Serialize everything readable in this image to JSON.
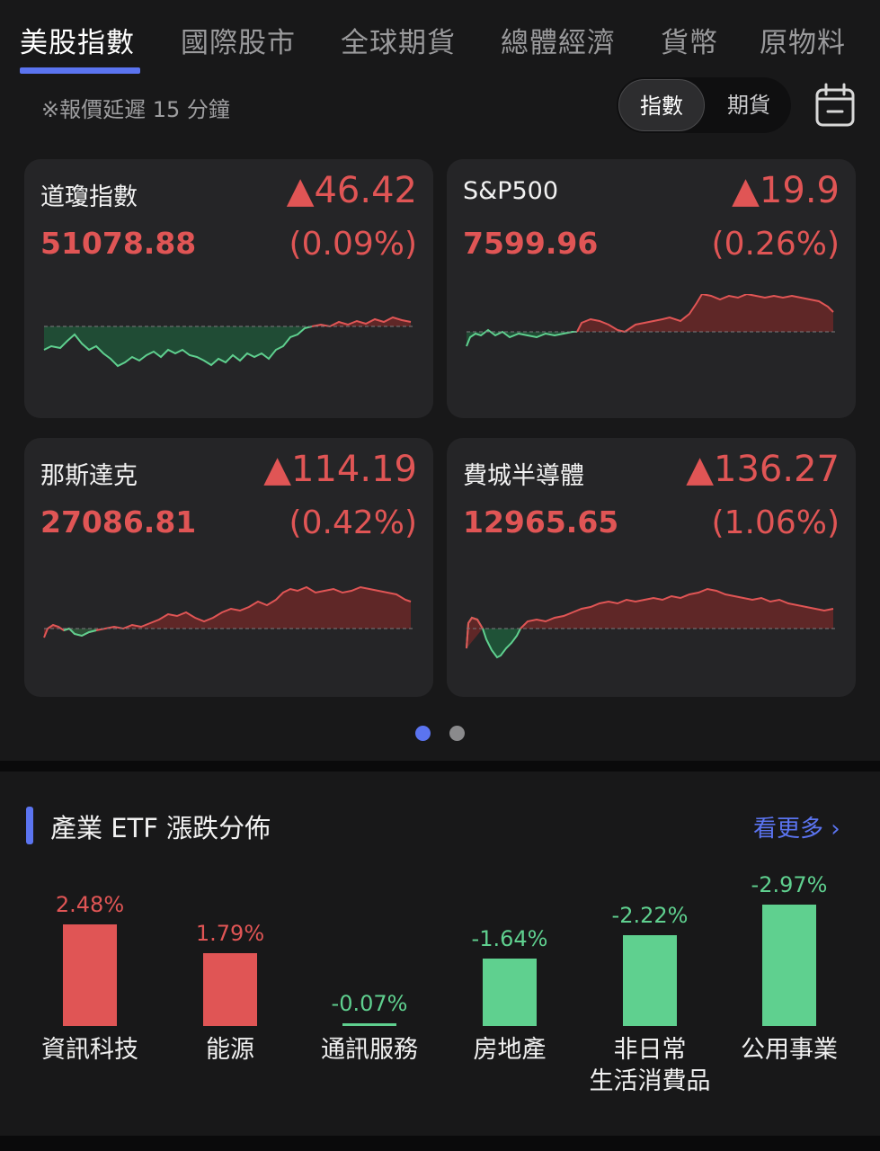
{
  "tabs": [
    "美股指數",
    "國際股市",
    "全球期貨",
    "總體經濟",
    "貨幣",
    "原物料"
  ],
  "delay_note": "※報價延遲 15 分鐘",
  "segment": {
    "active": "指數",
    "inactive": "期貨"
  },
  "colors": {
    "up": "#e05555",
    "down": "#5fd08f",
    "accent": "#5b74f0",
    "card_bg": "#252527"
  },
  "cards": [
    {
      "name": "道瓊指數",
      "change": "▲46.42",
      "price": "51078.88",
      "pct": "(0.09%)",
      "trend": "flat-up"
    },
    {
      "name": "S&P500",
      "change": "▲19.9",
      "price": "7599.96",
      "pct": "(0.26%)",
      "trend": "up"
    },
    {
      "name": "那斯達克",
      "change": "▲114.19",
      "price": "27086.81",
      "pct": "(0.42%)",
      "trend": "up"
    },
    {
      "name": "費城半導體",
      "change": "▲136.27",
      "price": "12965.65",
      "pct": "(1.06%)",
      "trend": "up"
    }
  ],
  "pager": {
    "pages": 2,
    "current": 1
  },
  "etf_section": {
    "title": "產業 ETF 漲跌分佈",
    "more_label": "看更多 ›",
    "items": [
      {
        "label": "資訊科技",
        "value": "2.48%",
        "num": 2.48
      },
      {
        "label": "能源",
        "value": "1.79%",
        "num": 1.79
      },
      {
        "label": "通訊服務",
        "value": "-0.07%",
        "num": -0.07
      },
      {
        "label": "房地產",
        "value": "-1.64%",
        "num": -1.64
      },
      {
        "label": "非日常\n生活消費品",
        "value": "-2.22%",
        "num": -2.22
      },
      {
        "label": "公用事業",
        "value": "-2.97%",
        "num": -2.97
      }
    ]
  }
}
